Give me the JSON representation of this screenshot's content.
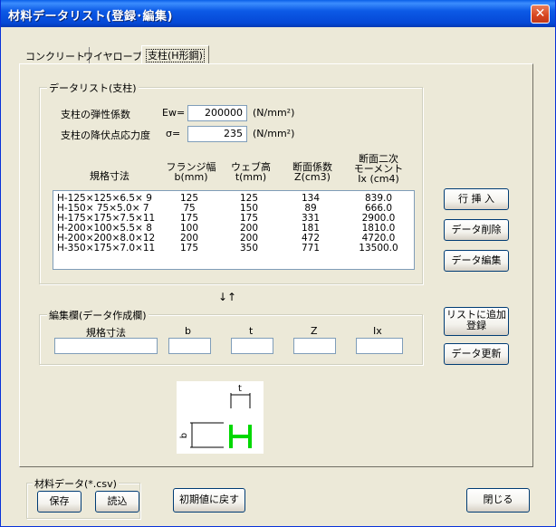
{
  "window": {
    "title": "材料データリスト(登録･編集)",
    "close": "✕"
  },
  "tabs": [
    {
      "label": "コンクリート"
    },
    {
      "label": "ワイヤロープ"
    },
    {
      "label": "支柱(H形鋼)"
    }
  ],
  "datalist": {
    "group_label": "データリスト(支柱)",
    "elastic_label": "支柱の弾性係数",
    "elastic_symbol": "Ew=",
    "elastic_value": "200000",
    "elastic_unit": "(N/mm²)",
    "yield_label": "支柱の降伏点応力度",
    "yield_symbol": "σ=",
    "yield_value": "235",
    "yield_unit": "(N/mm²)",
    "headers": {
      "spec": "規格寸法",
      "b1": "フランジ幅",
      "b2": "b(mm)",
      "t1": "ウェブ高",
      "t2": "t(mm)",
      "z1": "断面係数",
      "z2": "Z(cm3)",
      "i1": "断面二次",
      "i2": "モーメント",
      "i3": "Ix (cm4)"
    },
    "rows": [
      {
        "spec": "H-125×125×6.5× 9",
        "b": "125",
        "t": "125",
        "z": "134",
        "ix": "839.0"
      },
      {
        "spec": "H-150× 75×5.0× 7",
        "b": "75",
        "t": "150",
        "z": "89",
        "ix": "666.0"
      },
      {
        "spec": "H-175×175×7.5×11",
        "b": "175",
        "t": "175",
        "z": "331",
        "ix": "2900.0"
      },
      {
        "spec": "H-200×100×5.5× 8",
        "b": "100",
        "t": "200",
        "z": "181",
        "ix": "1810.0"
      },
      {
        "spec": "H-200×200×8.0×12",
        "b": "200",
        "t": "200",
        "z": "472",
        "ix": "4720.0"
      },
      {
        "spec": "H-350×175×7.0×11",
        "b": "175",
        "t": "350",
        "z": "771",
        "ix": "13500.0"
      }
    ]
  },
  "arrows": "↓↑",
  "edit": {
    "group_label": "編集欄(データ作成欄)",
    "spec_label": "規格寸法",
    "b_label": "b",
    "t_label": "t",
    "z_label": "Z",
    "ix_label": "Ix",
    "spec_value": "",
    "b_value": "",
    "t_value": "",
    "z_value": "",
    "ix_value": ""
  },
  "buttons": {
    "insert": "行 挿 入",
    "delete": "データ削除",
    "edit": "データ編集",
    "add_line1": "リストに追加",
    "add_line2": "登録",
    "update": "データ更新",
    "reset": "初期値に戻す",
    "close": "閉じる"
  },
  "csv": {
    "group_label": "材料データ(*.csv)",
    "save": "保存",
    "load": "読込"
  },
  "diagram": {
    "t_label": "t",
    "b_label": "b",
    "h_color": "#00d800"
  }
}
